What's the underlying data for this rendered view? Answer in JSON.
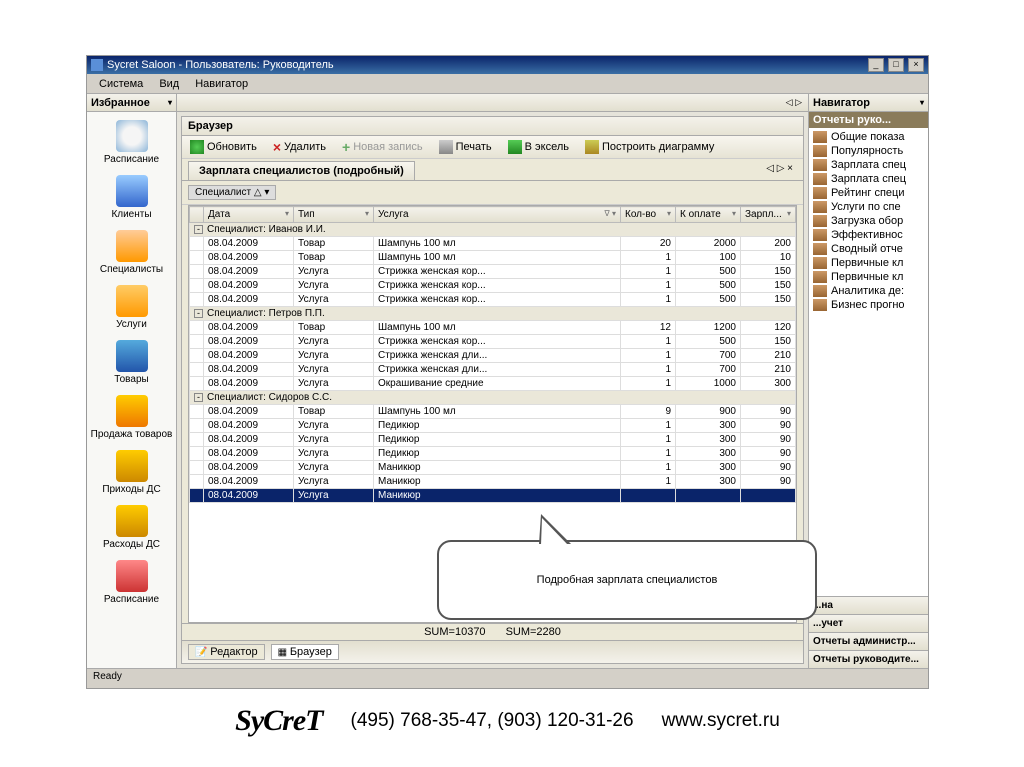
{
  "window": {
    "title": "Sycret Saloon - Пользователь: Руководитель",
    "btn_min": "_",
    "btn_max": "□",
    "btn_close": "×"
  },
  "menu": {
    "system": "Система",
    "view": "Вид",
    "navigator": "Навигатор"
  },
  "favorites": {
    "header": "Избранное",
    "items": [
      {
        "label": "Расписание"
      },
      {
        "label": "Клиенты"
      },
      {
        "label": "Специалисты"
      },
      {
        "label": "Услуги"
      },
      {
        "label": "Товары"
      },
      {
        "label": "Продажа товаров"
      },
      {
        "label": "Приходы ДС"
      },
      {
        "label": "Расходы ДС"
      },
      {
        "label": "Расписание"
      }
    ]
  },
  "navarrows": "◁ ▷",
  "browser": {
    "title": "Браузер",
    "toolbar": {
      "refresh": "Обновить",
      "delete": "Удалить",
      "new": "Новая запись",
      "print": "Печать",
      "excel": "В эксель",
      "chart": "Построить диаграмму"
    },
    "tab": "Зарплата специалистов (подробный)",
    "tab_close": "◁ ▷ ×",
    "group_chip": "Специалист △ ▾",
    "columns": {
      "date": "Дата",
      "type": "Тип",
      "service": "Услуга",
      "qty": "Кол-во",
      "topay": "К оплате",
      "salary": "Зарпл..."
    },
    "filter_glyph": "▾",
    "funnel_glyph": "∇",
    "groups": [
      {
        "header": "Специалист: Иванов И.И.",
        "rows": [
          {
            "date": "08.04.2009",
            "type": "Товар",
            "service": "Шампунь 100 мл",
            "qty": "20",
            "topay": "2000",
            "salary": "200"
          },
          {
            "date": "08.04.2009",
            "type": "Товар",
            "service": "Шампунь 100 мл",
            "qty": "1",
            "topay": "100",
            "salary": "10"
          },
          {
            "date": "08.04.2009",
            "type": "Услуга",
            "service": "Стрижка женская кор...",
            "qty": "1",
            "topay": "500",
            "salary": "150"
          },
          {
            "date": "08.04.2009",
            "type": "Услуга",
            "service": "Стрижка женская кор...",
            "qty": "1",
            "topay": "500",
            "salary": "150"
          },
          {
            "date": "08.04.2009",
            "type": "Услуга",
            "service": "Стрижка женская кор...",
            "qty": "1",
            "topay": "500",
            "salary": "150"
          }
        ]
      },
      {
        "header": "Специалист: Петров П.П.",
        "rows": [
          {
            "date": "08.04.2009",
            "type": "Товар",
            "service": "Шампунь 100 мл",
            "qty": "12",
            "topay": "1200",
            "salary": "120"
          },
          {
            "date": "08.04.2009",
            "type": "Услуга",
            "service": "Стрижка женская кор...",
            "qty": "1",
            "topay": "500",
            "salary": "150"
          },
          {
            "date": "08.04.2009",
            "type": "Услуга",
            "service": "Стрижка женская дли...",
            "qty": "1",
            "topay": "700",
            "salary": "210"
          },
          {
            "date": "08.04.2009",
            "type": "Услуга",
            "service": "Стрижка женская дли...",
            "qty": "1",
            "topay": "700",
            "salary": "210"
          },
          {
            "date": "08.04.2009",
            "type": "Услуга",
            "service": "Окрашивание средние",
            "qty": "1",
            "topay": "1000",
            "salary": "300"
          }
        ]
      },
      {
        "header": "Специалист: Сидоров С.С.",
        "rows": [
          {
            "date": "08.04.2009",
            "type": "Товар",
            "service": "Шампунь 100 мл",
            "qty": "9",
            "topay": "900",
            "salary": "90"
          },
          {
            "date": "08.04.2009",
            "type": "Услуга",
            "service": "Педикюр",
            "qty": "1",
            "topay": "300",
            "salary": "90"
          },
          {
            "date": "08.04.2009",
            "type": "Услуга",
            "service": "Педикюр",
            "qty": "1",
            "topay": "300",
            "salary": "90"
          },
          {
            "date": "08.04.2009",
            "type": "Услуга",
            "service": "Педикюр",
            "qty": "1",
            "topay": "300",
            "salary": "90"
          },
          {
            "date": "08.04.2009",
            "type": "Услуга",
            "service": "Маникюр",
            "qty": "1",
            "topay": "300",
            "salary": "90"
          },
          {
            "date": "08.04.2009",
            "type": "Услуга",
            "service": "Маникюр",
            "qty": "1",
            "topay": "300",
            "salary": "90"
          },
          {
            "date": "08.04.2009",
            "type": "Услуга",
            "service": "Маникюр",
            "qty": "",
            "topay": "",
            "salary": "",
            "sel": true
          }
        ]
      }
    ],
    "sum1": "SUM=10370",
    "sum2": "SUM=2280",
    "bottom_tabs": {
      "editor": "Редактор",
      "browser": "Браузер"
    }
  },
  "navigator": {
    "header": "Навигатор",
    "section": "Отчеты руко...",
    "items": [
      "Общие показа",
      "Популярность",
      "Зарплата спец",
      "Зарплата спец",
      "Рейтинг специ",
      "Услуги по спе",
      "Загрузка обор",
      "Эффективнос",
      "Сводный отче",
      "Первичные кл",
      "Первичные кл",
      "Аналитика де:",
      "Бизнес прогно"
    ],
    "foot": [
      "...на",
      "...учет",
      "Отчеты администр...",
      "Отчеты руководите..."
    ]
  },
  "status": "Ready",
  "callout": "Подробная зарплата специалистов",
  "footer": {
    "logo": "SyCreT",
    "phones": "(495) 768-35-47, (903) 120-31-26",
    "url": "www.sycret.ru"
  }
}
